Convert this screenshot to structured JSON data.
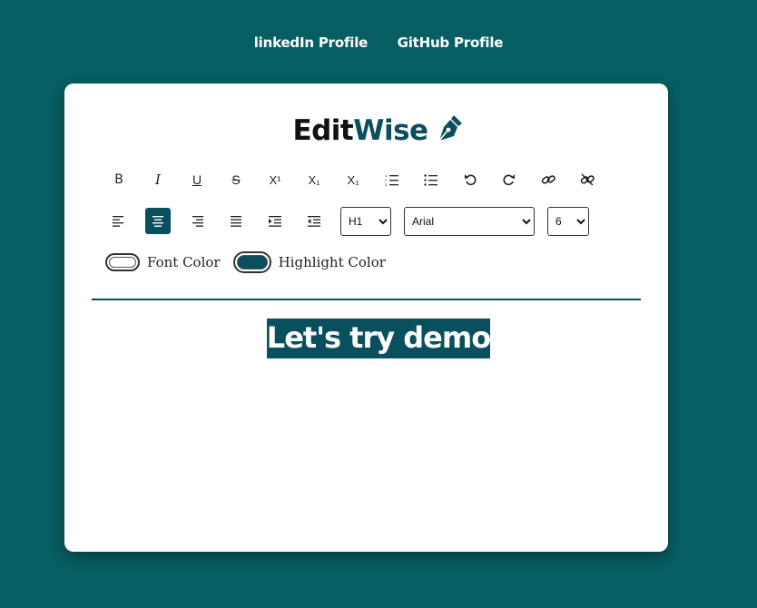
{
  "nav": {
    "linkedin": "linkedIn Profile",
    "github": "GitHub Profile"
  },
  "logo": {
    "part1": "Edit",
    "part2": "Wise",
    "icon": "pen-nib-icon"
  },
  "toolbar": {
    "row1": [
      {
        "name": "bold-button",
        "glyph": "B"
      },
      {
        "name": "italic-button",
        "glyph": "I"
      },
      {
        "name": "underline-button",
        "glyph": "U"
      },
      {
        "name": "strikethrough-button",
        "glyph": "S"
      },
      {
        "name": "superscript-button",
        "glyph": "X¹"
      },
      {
        "name": "subscript-button",
        "glyph": "X₁"
      },
      {
        "name": "subscript-alt-button",
        "glyph": "X₁"
      },
      {
        "name": "ordered-list-button",
        "glyph": "ordered-list-icon"
      },
      {
        "name": "unordered-list-button",
        "glyph": "unordered-list-icon"
      },
      {
        "name": "undo-button",
        "glyph": "undo-icon"
      },
      {
        "name": "redo-button",
        "glyph": "redo-icon"
      },
      {
        "name": "link-button",
        "glyph": "link-icon"
      },
      {
        "name": "unlink-button",
        "glyph": "unlink-icon"
      }
    ],
    "row2": [
      {
        "name": "align-left-button",
        "glyph": "align-left-icon"
      },
      {
        "name": "align-center-button",
        "glyph": "align-center-icon",
        "active": true
      },
      {
        "name": "align-right-button",
        "glyph": "align-right-icon"
      },
      {
        "name": "justify-button",
        "glyph": "justify-icon"
      },
      {
        "name": "indent-button",
        "glyph": "indent-icon"
      },
      {
        "name": "outdent-button",
        "glyph": "outdent-icon"
      }
    ],
    "heading_select": "H1",
    "font_select": "Arial",
    "size_select": "6"
  },
  "colors": {
    "font_color_label": "Font Color",
    "highlight_color_label": "Highlight Color",
    "font_color": "#ffffff",
    "highlight_color": "#0a4f5e"
  },
  "editor": {
    "content": "Let's try demo"
  },
  "theme": {
    "background": "#075e62",
    "accent": "#0a4f5e"
  }
}
